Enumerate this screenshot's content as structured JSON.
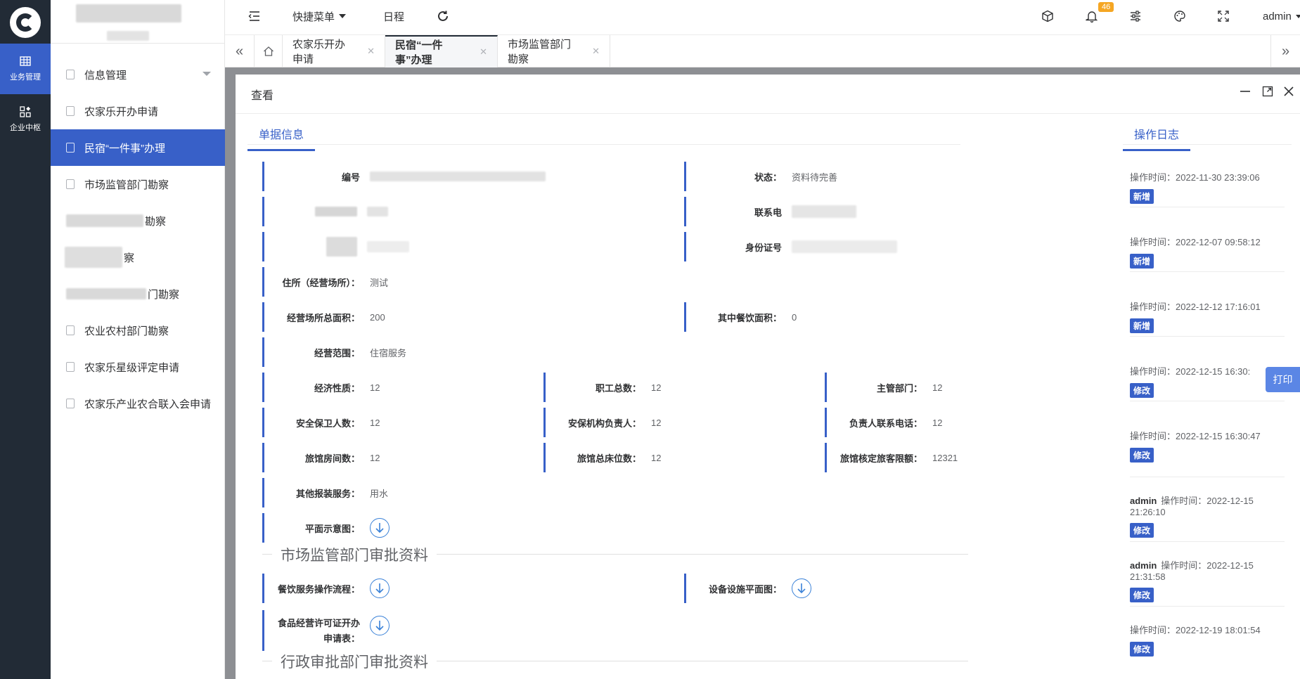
{
  "rail": {
    "items": [
      {
        "label": "业务管理"
      },
      {
        "label": "企业中枢"
      }
    ]
  },
  "sidebar": {
    "items": [
      {
        "label": "信息管理"
      },
      {
        "label": "农家乐开办申请"
      },
      {
        "label": "民宿“一件事”办理"
      },
      {
        "label": "市场监管部门勘察"
      },
      {
        "label": "勘察"
      },
      {
        "label": "察"
      },
      {
        "label": "门勘察"
      },
      {
        "label": "农业农村部门勘察"
      },
      {
        "label": "农家乐星级评定申请"
      },
      {
        "label": "农家乐产业农合联入会申请"
      }
    ]
  },
  "topbar": {
    "quick_menu": "快捷菜单",
    "schedule": "日程",
    "notification_count": "46",
    "user": "admin"
  },
  "tabs": [
    {
      "label": "农家乐开办申请"
    },
    {
      "label": "民宿“一件事”办理"
    },
    {
      "label": "市场监管部门勘察"
    }
  ],
  "dialog": {
    "title": "查看",
    "tab_info": "单据信息",
    "tab_log": "操作日志",
    "fields": {
      "bianhao": "编号",
      "zhuangtai_label": "状态：",
      "zhuangtai_value": "资料待完善",
      "lianxi_label": "联系电",
      "shenfen_label": "身份证号",
      "zhusuo_label": "住所（经营场所）：",
      "zhusuo_value": "测试",
      "zongmianji_label": "经营场所总面积：",
      "zongmianji_value": "200",
      "canyin_label": "其中餐饮面积：",
      "canyin_value": "0",
      "fanwei_label": "经营范围：",
      "fanwei_value": "住宿服务",
      "xingzhi_label": "经济性质：",
      "xingzhi_value": "12",
      "zhigong_label": "职工总数：",
      "zhigong_value": "12",
      "zhuguan_label": "主管部门：",
      "zhuguan_value": "12",
      "baowei_label": "安全保卫人数：",
      "baowei_value": "12",
      "anbao_label": "安保机构负责人：",
      "anbao_value": "12",
      "fuzeren_label": "负责人联系电话：",
      "fuzeren_value": "12",
      "fangjian_label": "旅馆房间数：",
      "fangjian_value": "12",
      "chuangwei_label": "旅馆总床位数：",
      "chuangwei_value": "12",
      "lvke_label": "旅馆核定旅客限额：",
      "lvke_value": "12321",
      "baozhuang_label": "其他报装服务：",
      "baozhuang_value": "用水",
      "pingmian_label": "平面示意图：",
      "canyin_liucheng_label": "餐饮服务操作流程：",
      "shebei_label": "设备设施平面图：",
      "xuke_label_1": "食品经营许可证开办",
      "xuke_label_2": "申请表："
    },
    "section_market": "市场监管部门审批资料",
    "section_admin": "行政审批部门审批资料",
    "log": [
      {
        "user": "",
        "time": "操作时间：2022-11-30 23:39:06",
        "action": "新增"
      },
      {
        "user": "",
        "time": "操作时间：2022-12-07 09:58:12",
        "action": "新增"
      },
      {
        "user": "",
        "time": "操作时间：2022-12-12 17:16:01",
        "action": "新增"
      },
      {
        "user": "",
        "time": "操作时间：2022-12-15 16:30:",
        "action": "修改"
      },
      {
        "user": "",
        "time": "操作时间：2022-12-15 16:30:47",
        "action": "修改"
      },
      {
        "user": "admin",
        "time": "操作时间：2022-12-15 21:26:10",
        "action": "修改"
      },
      {
        "user": "admin",
        "time": "操作时间：2022-12-15 21:31:58",
        "action": "修改"
      },
      {
        "user": "",
        "time": "操作时间：2022-12-19 18:01:54",
        "action": "修改"
      }
    ],
    "print": "打印"
  }
}
